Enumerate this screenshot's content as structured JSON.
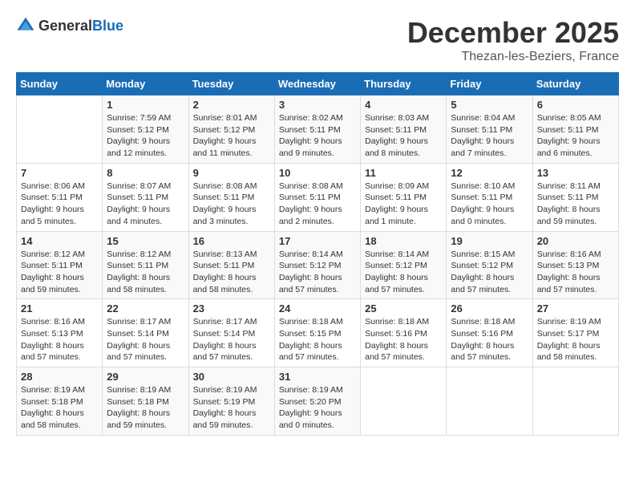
{
  "header": {
    "logo_general": "General",
    "logo_blue": "Blue",
    "month_title": "December 2025",
    "location": "Thezan-les-Beziers, France"
  },
  "weekdays": [
    "Sunday",
    "Monday",
    "Tuesday",
    "Wednesday",
    "Thursday",
    "Friday",
    "Saturday"
  ],
  "weeks": [
    [
      {
        "day": "",
        "info": ""
      },
      {
        "day": "1",
        "info": "Sunrise: 7:59 AM\nSunset: 5:12 PM\nDaylight: 9 hours\nand 12 minutes."
      },
      {
        "day": "2",
        "info": "Sunrise: 8:01 AM\nSunset: 5:12 PM\nDaylight: 9 hours\nand 11 minutes."
      },
      {
        "day": "3",
        "info": "Sunrise: 8:02 AM\nSunset: 5:11 PM\nDaylight: 9 hours\nand 9 minutes."
      },
      {
        "day": "4",
        "info": "Sunrise: 8:03 AM\nSunset: 5:11 PM\nDaylight: 9 hours\nand 8 minutes."
      },
      {
        "day": "5",
        "info": "Sunrise: 8:04 AM\nSunset: 5:11 PM\nDaylight: 9 hours\nand 7 minutes."
      },
      {
        "day": "6",
        "info": "Sunrise: 8:05 AM\nSunset: 5:11 PM\nDaylight: 9 hours\nand 6 minutes."
      }
    ],
    [
      {
        "day": "7",
        "info": "Sunrise: 8:06 AM\nSunset: 5:11 PM\nDaylight: 9 hours\nand 5 minutes."
      },
      {
        "day": "8",
        "info": "Sunrise: 8:07 AM\nSunset: 5:11 PM\nDaylight: 9 hours\nand 4 minutes."
      },
      {
        "day": "9",
        "info": "Sunrise: 8:08 AM\nSunset: 5:11 PM\nDaylight: 9 hours\nand 3 minutes."
      },
      {
        "day": "10",
        "info": "Sunrise: 8:08 AM\nSunset: 5:11 PM\nDaylight: 9 hours\nand 2 minutes."
      },
      {
        "day": "11",
        "info": "Sunrise: 8:09 AM\nSunset: 5:11 PM\nDaylight: 9 hours\nand 1 minute."
      },
      {
        "day": "12",
        "info": "Sunrise: 8:10 AM\nSunset: 5:11 PM\nDaylight: 9 hours\nand 0 minutes."
      },
      {
        "day": "13",
        "info": "Sunrise: 8:11 AM\nSunset: 5:11 PM\nDaylight: 8 hours\nand 59 minutes."
      }
    ],
    [
      {
        "day": "14",
        "info": "Sunrise: 8:12 AM\nSunset: 5:11 PM\nDaylight: 8 hours\nand 59 minutes."
      },
      {
        "day": "15",
        "info": "Sunrise: 8:12 AM\nSunset: 5:11 PM\nDaylight: 8 hours\nand 58 minutes."
      },
      {
        "day": "16",
        "info": "Sunrise: 8:13 AM\nSunset: 5:11 PM\nDaylight: 8 hours\nand 58 minutes."
      },
      {
        "day": "17",
        "info": "Sunrise: 8:14 AM\nSunset: 5:12 PM\nDaylight: 8 hours\nand 57 minutes."
      },
      {
        "day": "18",
        "info": "Sunrise: 8:14 AM\nSunset: 5:12 PM\nDaylight: 8 hours\nand 57 minutes."
      },
      {
        "day": "19",
        "info": "Sunrise: 8:15 AM\nSunset: 5:12 PM\nDaylight: 8 hours\nand 57 minutes."
      },
      {
        "day": "20",
        "info": "Sunrise: 8:16 AM\nSunset: 5:13 PM\nDaylight: 8 hours\nand 57 minutes."
      }
    ],
    [
      {
        "day": "21",
        "info": "Sunrise: 8:16 AM\nSunset: 5:13 PM\nDaylight: 8 hours\nand 57 minutes."
      },
      {
        "day": "22",
        "info": "Sunrise: 8:17 AM\nSunset: 5:14 PM\nDaylight: 8 hours\nand 57 minutes."
      },
      {
        "day": "23",
        "info": "Sunrise: 8:17 AM\nSunset: 5:14 PM\nDaylight: 8 hours\nand 57 minutes."
      },
      {
        "day": "24",
        "info": "Sunrise: 8:18 AM\nSunset: 5:15 PM\nDaylight: 8 hours\nand 57 minutes."
      },
      {
        "day": "25",
        "info": "Sunrise: 8:18 AM\nSunset: 5:16 PM\nDaylight: 8 hours\nand 57 minutes."
      },
      {
        "day": "26",
        "info": "Sunrise: 8:18 AM\nSunset: 5:16 PM\nDaylight: 8 hours\nand 57 minutes."
      },
      {
        "day": "27",
        "info": "Sunrise: 8:19 AM\nSunset: 5:17 PM\nDaylight: 8 hours\nand 58 minutes."
      }
    ],
    [
      {
        "day": "28",
        "info": "Sunrise: 8:19 AM\nSunset: 5:18 PM\nDaylight: 8 hours\nand 58 minutes."
      },
      {
        "day": "29",
        "info": "Sunrise: 8:19 AM\nSunset: 5:18 PM\nDaylight: 8 hours\nand 59 minutes."
      },
      {
        "day": "30",
        "info": "Sunrise: 8:19 AM\nSunset: 5:19 PM\nDaylight: 8 hours\nand 59 minutes."
      },
      {
        "day": "31",
        "info": "Sunrise: 8:19 AM\nSunset: 5:20 PM\nDaylight: 9 hours\nand 0 minutes."
      },
      {
        "day": "",
        "info": ""
      },
      {
        "day": "",
        "info": ""
      },
      {
        "day": "",
        "info": ""
      }
    ]
  ]
}
